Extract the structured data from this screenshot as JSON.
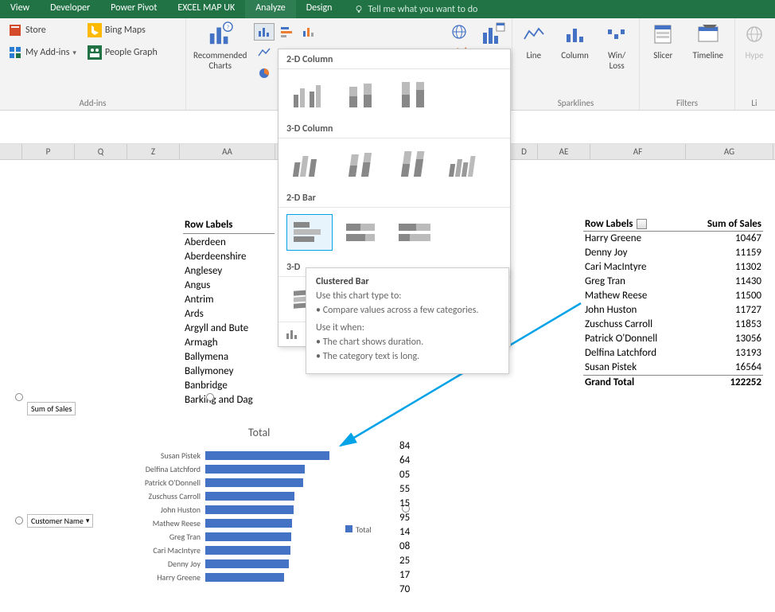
{
  "tabs": {
    "items": [
      "View",
      "Developer",
      "Power Pivot",
      "EXCEL MAP UK",
      "Analyze",
      "Design"
    ],
    "tellme": "Tell me what you want to do"
  },
  "ribbon": {
    "addins": {
      "store": "Store",
      "myaddins": "My Add-ins",
      "bing": "Bing Maps",
      "people": "People Graph",
      "label": "Add-ins"
    },
    "reccharts": {
      "line1": "Recommended",
      "line2": "Charts"
    },
    "sparklines": {
      "line": "Line",
      "column": "Column",
      "winloss_1": "Win/",
      "winloss_2": "Loss",
      "label": "Sparklines"
    },
    "filters": {
      "slicer": "Slicer",
      "timeline": "Timeline",
      "label": "Filters"
    },
    "links": {
      "hyper": "Hype",
      "label": "Li"
    }
  },
  "dropdown": {
    "col2d": "2-D Column",
    "col3d": "3-D Column",
    "bar2d": "2-D Bar",
    "bar3dPartial": "3-D"
  },
  "tooltip": {
    "title": "Clustered Bar",
    "useTo": "Use this chart type to:",
    "b1": "• Compare values across a few categories.",
    "when": "Use it when:",
    "b2": "• The chart shows duration.",
    "b3": "• The category text is long."
  },
  "columns": [
    "P",
    "Q",
    "Z",
    "AA",
    "",
    "",
    "",
    "D",
    "AE",
    "AF",
    "AG"
  ],
  "pivotLeft": {
    "header": "Row Labels",
    "rows": [
      "Aberdeen",
      "Aberdeenshire",
      "Anglesey",
      "Angus",
      "Antrim",
      "Ards",
      "Argyll and Bute",
      "Armagh",
      "Ballymena",
      "Ballymoney",
      "Banbridge",
      "Barking and Dag"
    ]
  },
  "pivotRight": {
    "h1": "Row Labels",
    "h2": "Sum of Sales",
    "rows": [
      {
        "name": "Harry Greene",
        "val": 10467
      },
      {
        "name": "Denny Joy",
        "val": 11159
      },
      {
        "name": "Cari MacIntyre",
        "val": 11302
      },
      {
        "name": "Greg Tran",
        "val": 11430
      },
      {
        "name": "Mathew Reese",
        "val": 11500
      },
      {
        "name": "John Huston",
        "val": 11727
      },
      {
        "name": "Zuschuss Carroll",
        "val": 11853
      },
      {
        "name": "Patrick O'Donnell",
        "val": 13056
      },
      {
        "name": "Delfina Latchford",
        "val": 13193
      },
      {
        "name": "Susan Pistek",
        "val": 16564
      }
    ],
    "grandLabel": "Grand Total",
    "grandVal": 122252
  },
  "chart_data": {
    "type": "bar",
    "title": "Total",
    "field_value": "Sum of Sales",
    "field_axis": "Customer Name",
    "legend": "Total",
    "categories": [
      "Susan Pistek",
      "Delfina Latchford",
      "Patrick O'Donnell",
      "Zuschuss Carroll",
      "John Huston",
      "Mathew Reese",
      "Greg Tran",
      "Cari MacIntyre",
      "Denny Joy",
      "Harry Greene"
    ],
    "values": [
      16564,
      13193,
      13056,
      11853,
      11727,
      11500,
      11430,
      11302,
      11159,
      10467
    ],
    "xlim": [
      0,
      18000
    ]
  },
  "overlayNums": [
    "84",
    "64",
    "05",
    "55",
    "15",
    "95",
    "14",
    "08",
    "25",
    "17",
    "70"
  ]
}
